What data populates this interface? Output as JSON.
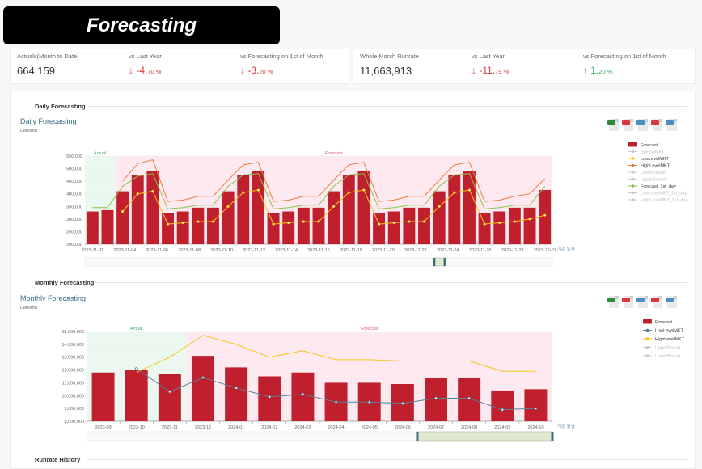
{
  "header": {
    "title": "Forecasting"
  },
  "kpis_left": [
    {
      "label": "Actuals(Month to Date)",
      "value": "664,159"
    },
    {
      "label": "vs Last Year",
      "direction": "down",
      "value": "-4.",
      "small": "70 %"
    },
    {
      "label": "vs Forecasting on 1st of Month",
      "direction": "down",
      "value": "-3.",
      "small": "20 %"
    }
  ],
  "kpis_right": [
    {
      "label": "Whole Month Runrate",
      "value": "11,663,913"
    },
    {
      "label": "vs Last Year",
      "direction": "down",
      "value": "-11.",
      "small": "79 %"
    },
    {
      "label": "vs Forecasting on 1st of Month",
      "direction": "up",
      "value": "1.",
      "small": "20 %"
    }
  ],
  "daily": {
    "section_title": "Daily Forecasting",
    "chart_title": "Daily Forecasting",
    "subtitle": "Demand",
    "region_actual": "Actual",
    "region_forecast": "Forecast",
    "x_axis_name": "기준 일자",
    "export_icons": [
      "excel-icon",
      "pdf-icon",
      "image-icon",
      "pdf-icon",
      "image-icon"
    ]
  },
  "monthly": {
    "section_title": "Monthly Forecasting",
    "chart_title": "Monthly Forecasting",
    "subtitle": "Demand",
    "region_actual": "Actual",
    "region_forecast": "Forecast",
    "x_axis_name": "기준 월별",
    "export_icons": [
      "excel-icon",
      "pdf-icon",
      "image-icon",
      "pdf-icon",
      "image-icon"
    ]
  },
  "runrate": {
    "section_title": "Runrate History"
  },
  "colors": {
    "bar": "#c0202e",
    "actual_band": "#eaf8ef",
    "forecast_band": "#fde9ef",
    "low": "#f5c518",
    "high": "#ef7b3a",
    "forecast1st": "#8bc34a",
    "lowlevel_monthly": "#5b7f95",
    "grey": "#c8c8c8"
  },
  "chart_data": [
    {
      "type": "bar",
      "title": "Daily Forecasting",
      "ylabel": "Demand",
      "xlabel": "기준 일자",
      "ylim": [
        200000,
        550000
      ],
      "y_ticks": [
        "200,000",
        "250,000",
        "300,000",
        "350,000",
        "400,000",
        "450,000",
        "500,000",
        "550,000"
      ],
      "x_ticks": [
        "2023-11-01",
        "2023-11-04",
        "2023-11-06",
        "2023-11-08",
        "2023-11-10",
        "2023-11-12",
        "2023-11-14",
        "2023-11-16",
        "2023-11-18",
        "2023-11-20",
        "2023-11-22",
        "2023-11-24",
        "2023-11-26",
        "2023-11-28",
        "2023-12-01"
      ],
      "actual_count": 2,
      "legend_position": "right",
      "legend": [
        {
          "name": "Forecast",
          "style": "bar",
          "color": "#c0202e",
          "active": true
        },
        {
          "name": "SpecialMKT",
          "style": "line",
          "color": "#c8c8c8",
          "active": false
        },
        {
          "name": "LowLevelMKT",
          "style": "line",
          "color": "#f5c518",
          "active": true
        },
        {
          "name": "HighLevelMKT",
          "style": "line",
          "color": "#ef7b3a",
          "active": true
        },
        {
          "name": "LowerBound",
          "style": "line",
          "color": "#c8c8c8",
          "active": false
        },
        {
          "name": "UpperBound",
          "style": "line",
          "color": "#c8c8c8",
          "active": false
        },
        {
          "name": "Forecast_1st_day",
          "style": "line",
          "color": "#8bc34a",
          "active": true
        },
        {
          "name": "LowLevelMKT_1st_day",
          "style": "line",
          "color": "#c8c8c8",
          "active": false
        },
        {
          "name": "HighLevelMKT_1st_day",
          "style": "line",
          "color": "#c8c8c8",
          "active": false
        }
      ],
      "series": [
        {
          "name": "Forecast",
          "values": [
            330000,
            335000,
            410000,
            475000,
            490000,
            325000,
            330000,
            345000,
            345000,
            410000,
            475000,
            490000,
            325000,
            330000,
            345000,
            345000,
            410000,
            475000,
            490000,
            325000,
            330000,
            345000,
            345000,
            410000,
            475000,
            490000,
            325000,
            330000,
            345000,
            345000,
            415000
          ]
        },
        {
          "name": "LowLevelMKT",
          "values": [
            null,
            null,
            330000,
            400000,
            410000,
            280000,
            285000,
            290000,
            290000,
            350000,
            405000,
            415000,
            280000,
            285000,
            290000,
            290000,
            350000,
            405000,
            415000,
            280000,
            285000,
            290000,
            290000,
            350000,
            405000,
            415000,
            280000,
            285000,
            290000,
            300000,
            315000
          ]
        },
        {
          "name": "HighLevelMKT",
          "values": [
            null,
            null,
            450000,
            520000,
            535000,
            370000,
            375000,
            390000,
            390000,
            455000,
            515000,
            525000,
            370000,
            375000,
            390000,
            390000,
            455000,
            515000,
            525000,
            370000,
            375000,
            390000,
            390000,
            455000,
            515000,
            525000,
            370000,
            375000,
            390000,
            400000,
            460000
          ]
        },
        {
          "name": "Forecast_1st_day",
          "values": [
            345000,
            345000,
            430000,
            470000,
            480000,
            340000,
            345000,
            355000,
            355000,
            430000,
            475000,
            480000,
            340000,
            345000,
            355000,
            355000,
            430000,
            475000,
            480000,
            340000,
            345000,
            355000,
            355000,
            430000,
            475000,
            480000,
            340000,
            345000,
            355000,
            355000,
            430000
          ]
        }
      ]
    },
    {
      "type": "bar",
      "title": "Monthly Forecasting",
      "ylabel": "Demand",
      "xlabel": "기준 월별",
      "ylim": [
        8000000,
        15000000
      ],
      "y_ticks": [
        "8,000,000",
        "9,000,000",
        "10,000,000",
        "11,000,000",
        "12,000,000",
        "13,000,000",
        "14,000,000",
        "15,000,000"
      ],
      "categories": [
        "2023-09",
        "2023-10",
        "2023-11",
        "2023-12",
        "2024-01",
        "2024-02",
        "2024-03",
        "2024-04",
        "2024-05",
        "2024-06",
        "2024-07",
        "2024-08",
        "2024-09",
        "2024-10"
      ],
      "actual_count": 3,
      "legend_position": "right",
      "legend": [
        {
          "name": "Forecast",
          "style": "bar",
          "color": "#c0202e",
          "active": true
        },
        {
          "name": "LowLevelMKT",
          "style": "line",
          "color": "#5b7f95",
          "active": true
        },
        {
          "name": "HighLevelMKT",
          "style": "line",
          "color": "#f5c518",
          "active": true
        },
        {
          "name": "UpperBound",
          "style": "line",
          "color": "#c8c8c8",
          "active": false
        },
        {
          "name": "LowerBound",
          "style": "line",
          "color": "#c8c8c8",
          "active": false
        }
      ],
      "series": [
        {
          "name": "Forecast",
          "values": [
            11800000,
            12000000,
            11700000,
            13100000,
            12200000,
            11500000,
            11800000,
            11000000,
            11000000,
            10900000,
            11400000,
            11400000,
            10400000,
            10500000
          ]
        },
        {
          "name": "LowLevelMKT",
          "values": [
            null,
            12100000,
            10300000,
            11400000,
            10600000,
            9900000,
            10100000,
            9500000,
            9500000,
            9400000,
            9800000,
            9800000,
            8900000,
            9000000
          ]
        },
        {
          "name": "HighLevelMKT",
          "values": [
            null,
            11800000,
            13000000,
            14700000,
            14000000,
            13000000,
            13500000,
            12800000,
            12800000,
            12700000,
            12700000,
            12700000,
            11900000,
            11900000
          ]
        }
      ]
    }
  ]
}
